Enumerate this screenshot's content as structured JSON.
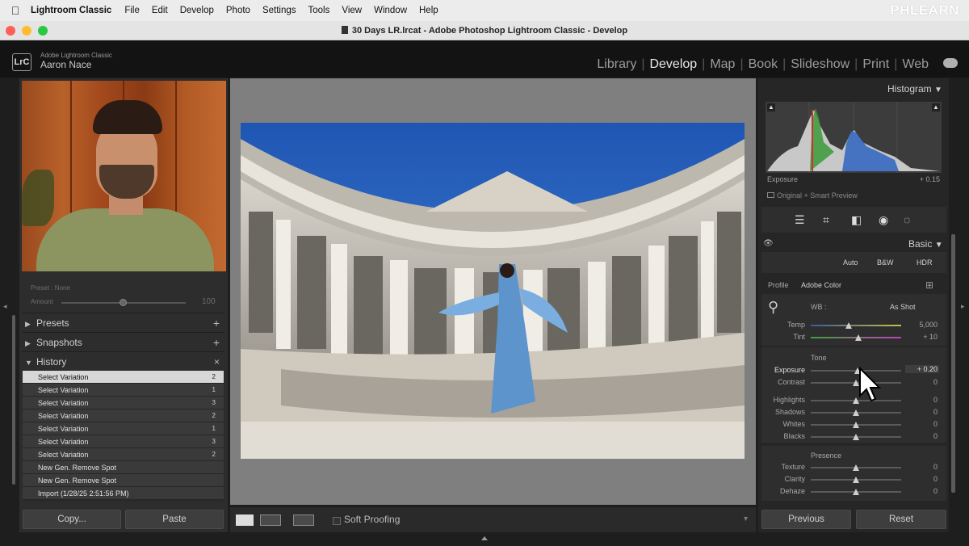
{
  "menubar": {
    "app": "Lightroom Classic",
    "items": [
      "File",
      "Edit",
      "Develop",
      "Photo",
      "Settings",
      "Tools",
      "View",
      "Window",
      "Help"
    ],
    "watermark": "PHLEARN"
  },
  "window": {
    "title": "30 Days LR.lrcat - Adobe Photoshop Lightroom Classic - Develop",
    "controls": {
      "close": "#fe5f57",
      "minimize": "#febc2e",
      "zoom": "#28c840"
    }
  },
  "identity": {
    "logo": "LrC",
    "app_name": "Adobe Lightroom Classic",
    "user": "Aaron Nace"
  },
  "modules": [
    "Library",
    "Develop",
    "Map",
    "Book",
    "Slideshow",
    "Print",
    "Web"
  ],
  "active_module": "Develop",
  "left_panel": {
    "preset_label": "Preset : None",
    "amount_label": "Amount",
    "amount_value": "100",
    "presets": "Presets",
    "snapshots": "Snapshots",
    "history": "History",
    "history_items": [
      {
        "label": "Select Variation",
        "count": "2"
      },
      {
        "label": "Select Variation",
        "count": "1"
      },
      {
        "label": "Select Variation",
        "count": "3"
      },
      {
        "label": "Select Variation",
        "count": "2"
      },
      {
        "label": "Select Variation",
        "count": "1"
      },
      {
        "label": "Select Variation",
        "count": "3"
      },
      {
        "label": "Select Variation",
        "count": "2"
      },
      {
        "label": "New Gen. Remove Spot",
        "count": ""
      },
      {
        "label": "New Gen. Remove Spot",
        "count": ""
      },
      {
        "label": "Import (1/28/25 2:51:56 PM)",
        "count": ""
      }
    ],
    "copy_button": "Copy...",
    "paste_button": "Paste"
  },
  "toolbar": {
    "soft_proofing": "Soft Proofing"
  },
  "right_panel": {
    "histogram_title": "Histogram",
    "histo_readout_label": "Exposure",
    "histo_readout_value": "+ 0.15",
    "preview_status": "Original + Smart Preview",
    "basic_title": "Basic",
    "treatment": {
      "auto": "Auto",
      "bw": "B&W",
      "hdr": "HDR"
    },
    "profile_label": "Profile",
    "profile_value": "Adobe Color",
    "wb_label": "WB :",
    "wb_value": "As Shot",
    "temp": {
      "label": "Temp",
      "value": "5,000"
    },
    "tint": {
      "label": "Tint",
      "value": "+ 10"
    },
    "tone_title": "Tone",
    "exposure": {
      "label": "Exposure",
      "value": "+ 0.20"
    },
    "contrast": {
      "label": "Contrast",
      "value": "0"
    },
    "highlights": {
      "label": "Highlights",
      "value": "0"
    },
    "shadows": {
      "label": "Shadows",
      "value": "0"
    },
    "whites": {
      "label": "Whites",
      "value": "0"
    },
    "blacks": {
      "label": "Blacks",
      "value": "0"
    },
    "presence_title": "Presence",
    "texture": {
      "label": "Texture",
      "value": "0"
    },
    "clarity": {
      "label": "Clarity",
      "value": "0"
    },
    "dehaze": {
      "label": "Dehaze",
      "value": "0"
    },
    "previous_button": "Previous",
    "reset_button": "Reset"
  },
  "sliders": {
    "temp": 0.42,
    "tint": 0.53,
    "exposure": 0.52,
    "contrast": 0.5,
    "highlights": 0.5,
    "shadows": 0.5,
    "whites": 0.5,
    "blacks": 0.5,
    "texture": 0.5,
    "clarity": 0.5,
    "dehaze": 0.5,
    "amount": 0.5
  }
}
